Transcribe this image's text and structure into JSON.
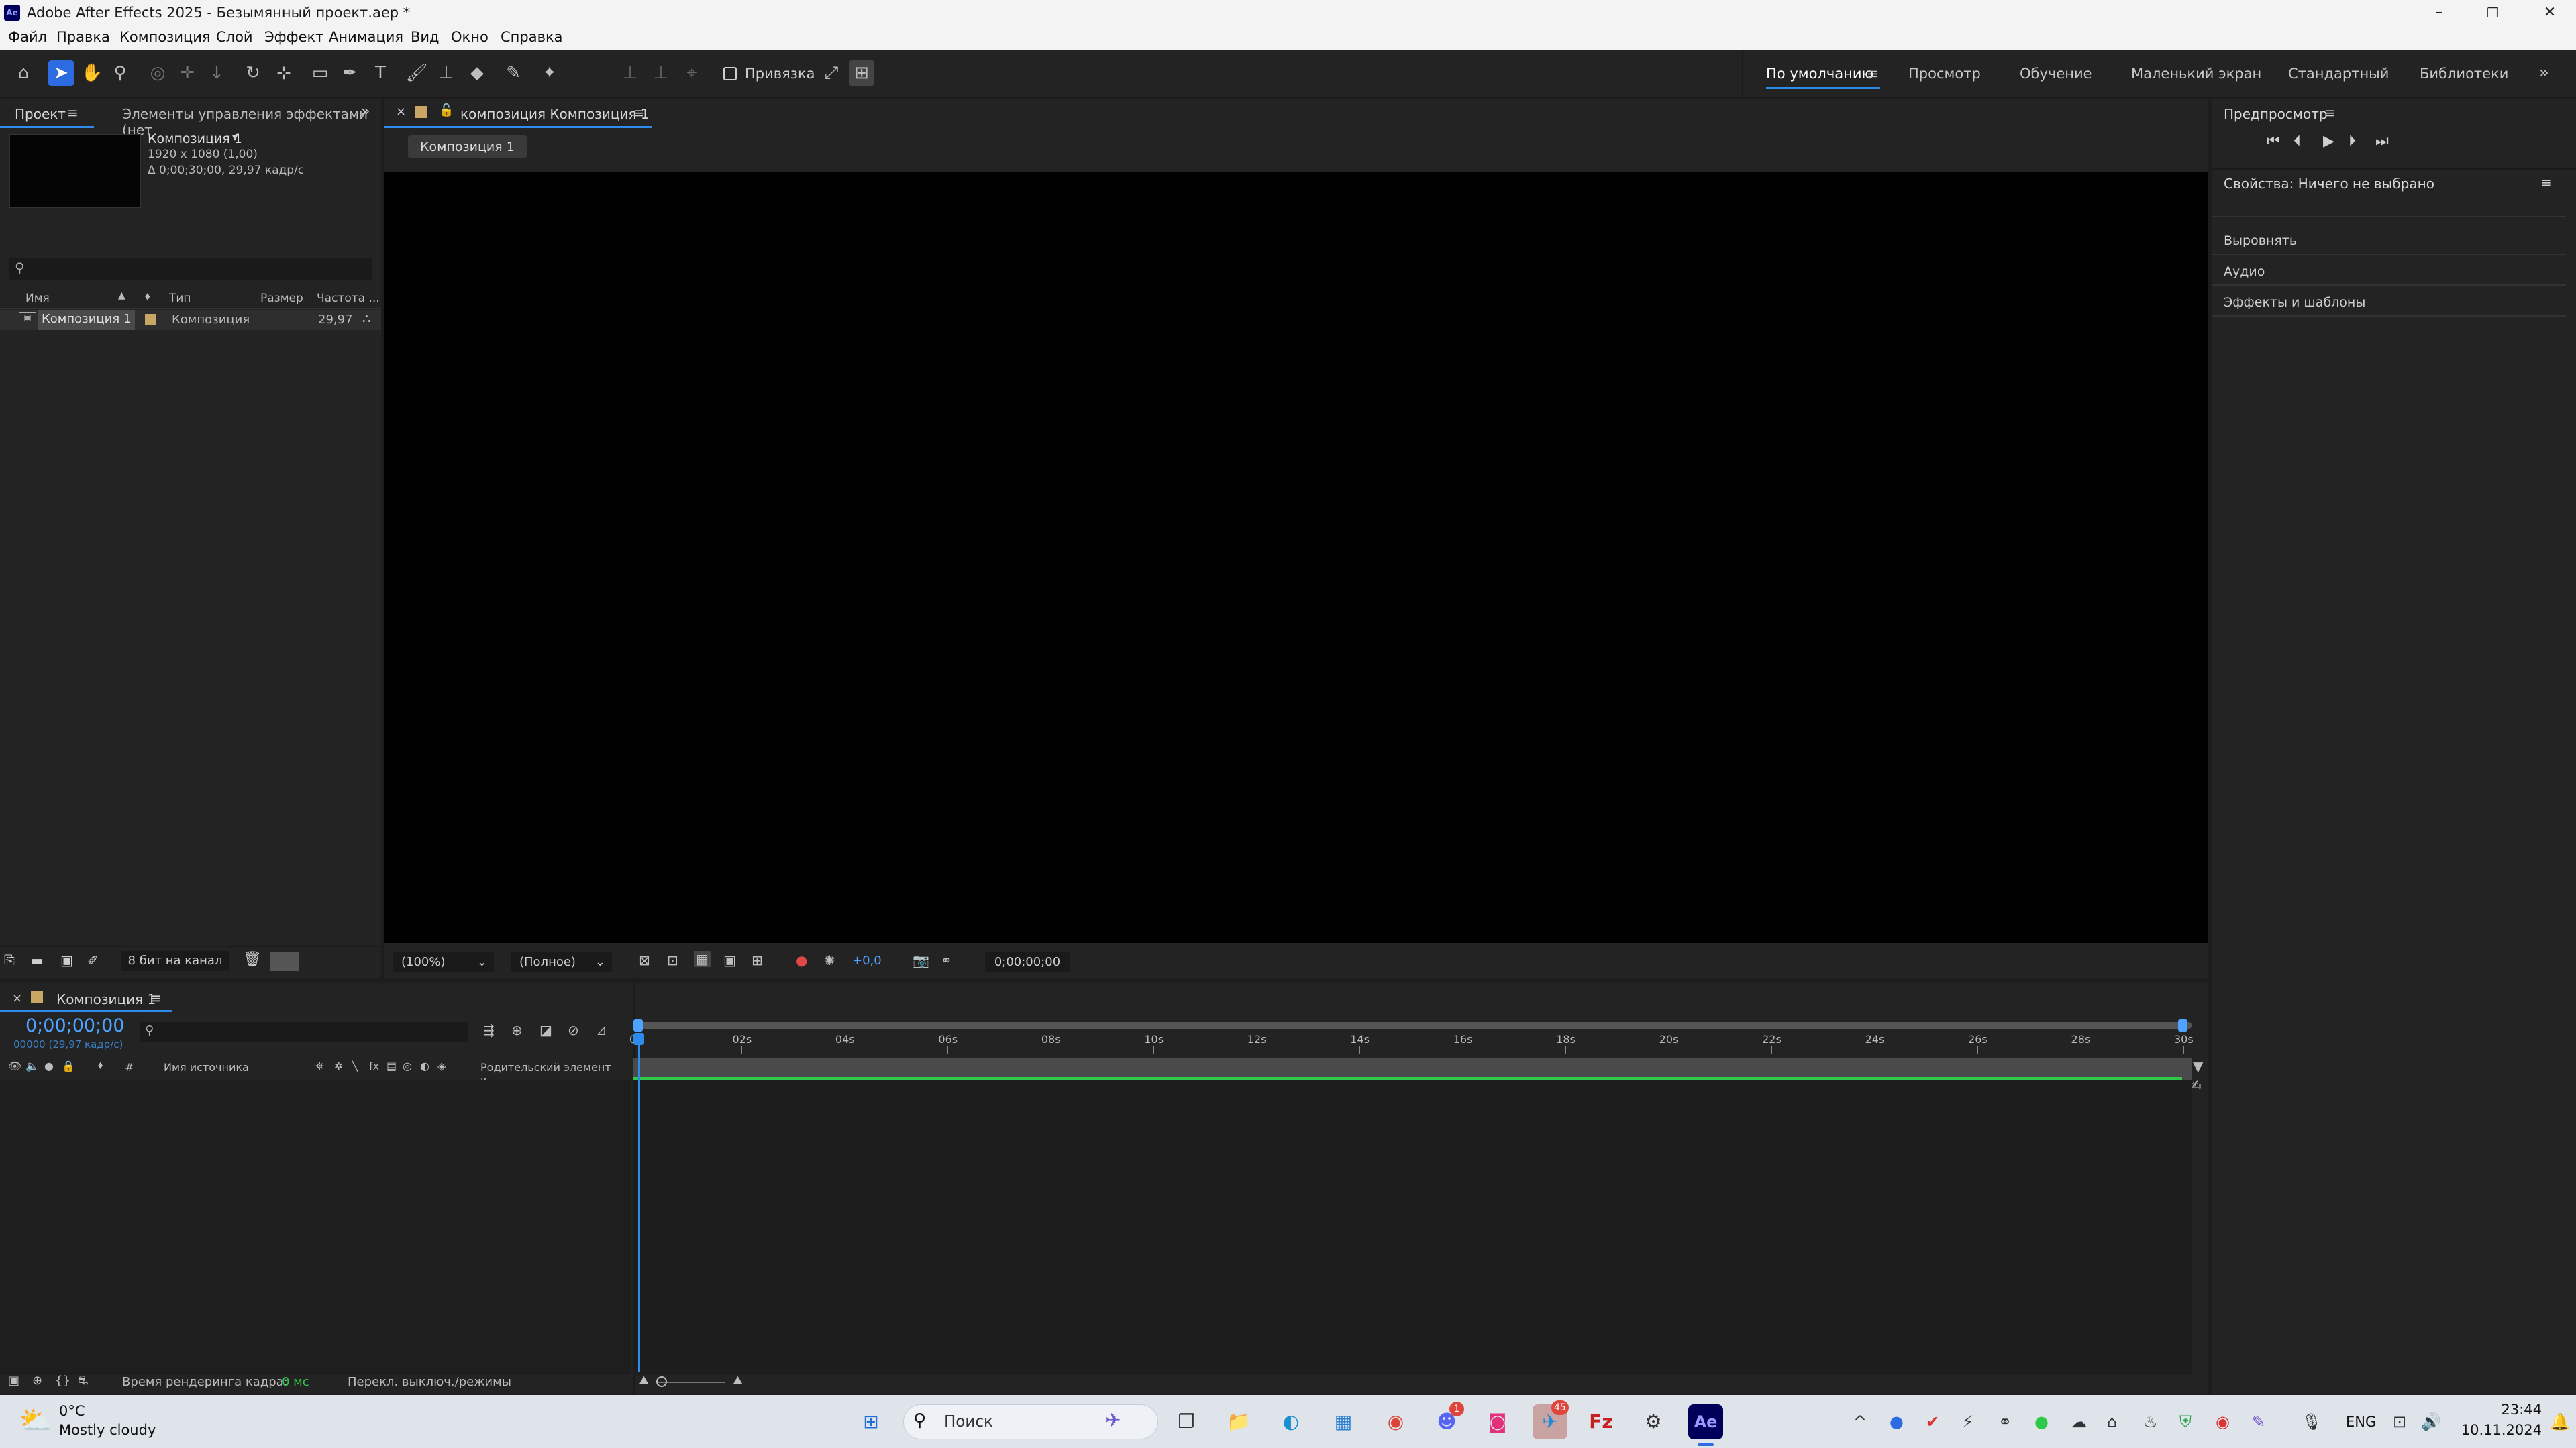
{
  "window": {
    "app_icon": "Ae",
    "title": "Adobe After Effects 2025 - Безымянный проект.aep *",
    "controls": [
      "minimize-icon",
      "maximize-icon",
      "close-icon"
    ]
  },
  "menu": [
    "Файл",
    "Правка",
    "Композиция",
    "Слой",
    "Эффект",
    "Анимация",
    "Вид",
    "Окно",
    "Справка"
  ],
  "toolbar": {
    "snap_label": "Привязка",
    "workspaces": [
      "По умолчанию",
      "Просмотр",
      "Обучение",
      "Маленький экран",
      "Стандартный",
      "Библиотеки"
    ],
    "active_workspace": "По умолчанию"
  },
  "project_panel": {
    "tab_project": "Проект",
    "tab_effects": "Элементы управления эффектами (нет",
    "comp_name": "Композиция 1",
    "comp_res": "1920 x 1080 (1,00)",
    "comp_duration": "Δ 0;00;30;00, 29,97 кадр/с",
    "search_placeholder": "",
    "columns": {
      "name": "Имя",
      "type": "Тип",
      "size": "Размер",
      "fps": "Частота ..."
    },
    "rows": [
      {
        "name": "Композиция 1",
        "type": "Композиция",
        "size": "",
        "fps": "29,97"
      }
    ],
    "bit_depth": "8 бит на канал"
  },
  "comp_panel": {
    "tab_title": "композиция Композиция 1",
    "breadcrumb": "Композиция 1",
    "zoom": "(100%)",
    "resolution": "(Полное)",
    "exposure": "+0,0",
    "timecode": "0;00;00;00"
  },
  "right_panel": {
    "preview_title": "Предпросмотр",
    "properties_title": "Свойства: Ничего не выбрано",
    "sections": [
      "Выровнять",
      "Аудио",
      "Эффекты и шаблоны"
    ]
  },
  "timeline": {
    "tab_title": "Композиция 1",
    "timecode": "0;00;00;00",
    "frame_info": "00000 (29,97 кадр/с)",
    "col_source": "Имя источника",
    "col_parent": "Родительский элемент и...",
    "col_hash": "#",
    "ruler": [
      "0s",
      "02s",
      "04s",
      "06s",
      "08s",
      "10s",
      "12s",
      "14s",
      "16s",
      "18s",
      "20s",
      "22s",
      "24s",
      "26s",
      "28s",
      "30s"
    ],
    "render_label": "Время рендеринга кадра:",
    "render_value": "0 мс",
    "toggle_label": "Перекл. выключ./режимы"
  },
  "taskbar": {
    "weather_temp": "0°C",
    "weather_desc": "Mostly cloudy",
    "search_label": "Поиск",
    "lang": "ENG",
    "time": "23:44",
    "date": "10.11.2024",
    "discord_badge": "1",
    "telegram_badge": "45"
  },
  "colors": {
    "accent": "#2d8ceb",
    "timecode": "#4da3ff",
    "green_bar": "#2ec84a",
    "taskbar": "#dfe4ea"
  }
}
